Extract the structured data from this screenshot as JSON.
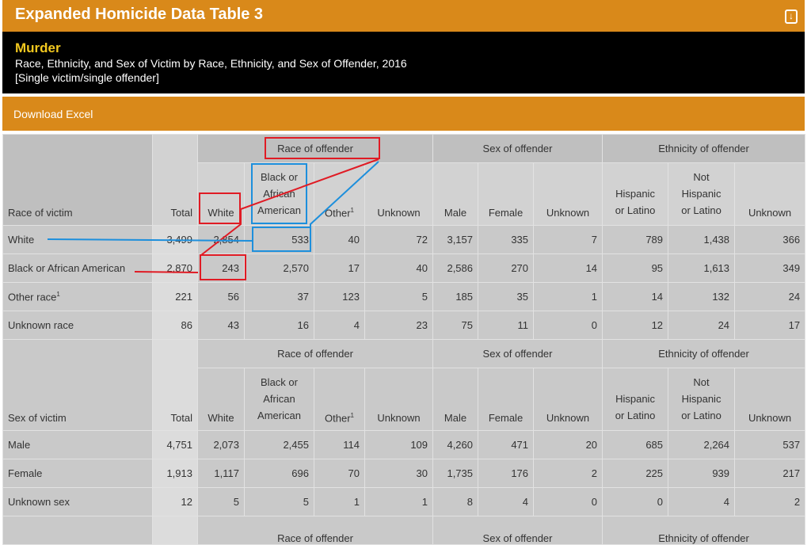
{
  "header": {
    "title": "Expanded Homicide Data Table 3",
    "download_icon": "download-icon"
  },
  "caption": {
    "heading": "Murder",
    "subtitle": "Race, Ethnicity, and Sex of Victim by Race, Ethnicity, and Sex of Offender, 2016",
    "note": "[Single victim/single offender]"
  },
  "download_excel": "Download Excel",
  "table": {
    "groups": {
      "race": "Race of offender",
      "sex": "Sex of offender",
      "ethnicity": "Ethnicity of offender"
    },
    "columns": {
      "race_of_victim": "Race of victim",
      "sex_of_victim": "Sex of victim",
      "total": "Total",
      "white": "White",
      "black_line1": "Black or",
      "black_line2": "African",
      "black_line3": "American",
      "other": "Other",
      "other_sup": "1",
      "unknown": "Unknown",
      "male": "Male",
      "female": "Female",
      "hispanic_line1": "Hispanic",
      "hispanic_line2": "or Latino",
      "not_hispanic_line1": "Not",
      "not_hispanic_line2": "Hispanic",
      "not_hispanic_line3": "or Latino"
    },
    "race_rows": [
      {
        "label": "White",
        "sup": "",
        "values": [
          "3,499",
          "2,854",
          "533",
          "40",
          "72",
          "3,157",
          "335",
          "7",
          "789",
          "1,438",
          "366"
        ]
      },
      {
        "label": "Black or African American",
        "sup": "",
        "values": [
          "2,870",
          "243",
          "2,570",
          "17",
          "40",
          "2,586",
          "270",
          "14",
          "95",
          "1,613",
          "349"
        ]
      },
      {
        "label": "Other race",
        "sup": "1",
        "values": [
          "221",
          "56",
          "37",
          "123",
          "5",
          "185",
          "35",
          "1",
          "14",
          "132",
          "24"
        ]
      },
      {
        "label": "Unknown race",
        "sup": "",
        "values": [
          "86",
          "43",
          "16",
          "4",
          "23",
          "75",
          "11",
          "0",
          "12",
          "24",
          "17"
        ]
      }
    ],
    "sex_rows": [
      {
        "label": "Male",
        "values": [
          "4,751",
          "2,073",
          "2,455",
          "114",
          "109",
          "4,260",
          "471",
          "20",
          "685",
          "2,264",
          "537"
        ]
      },
      {
        "label": "Female",
        "values": [
          "1,913",
          "1,117",
          "696",
          "70",
          "30",
          "1,735",
          "176",
          "2",
          "225",
          "939",
          "217"
        ]
      },
      {
        "label": "Unknown sex",
        "values": [
          "12",
          "5",
          "5",
          "1",
          "1",
          "8",
          "4",
          "0",
          "0",
          "4",
          "2"
        ]
      }
    ],
    "partial_next_groups": {
      "race": "Race of offender",
      "sex": "Sex of offender",
      "ethnicity": "Ethnicity of offender"
    }
  },
  "annotation_colors": {
    "red": "#e01b24",
    "blue": "#1d8fdc"
  }
}
